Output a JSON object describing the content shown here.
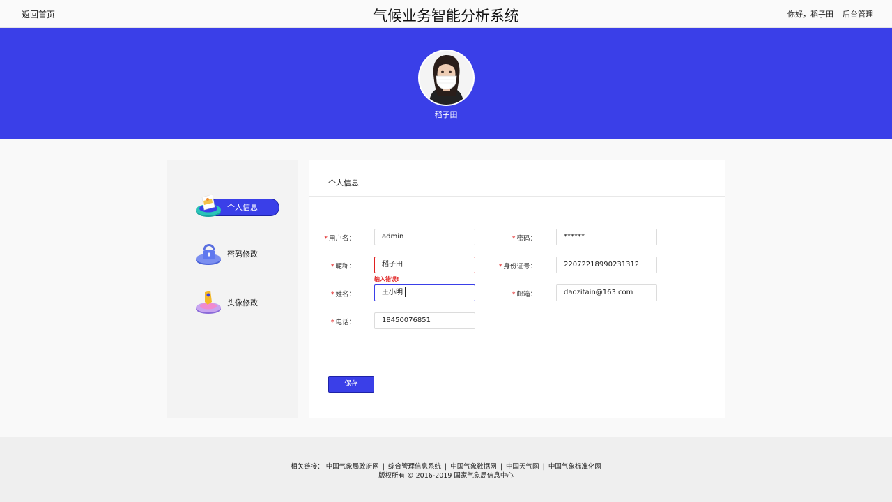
{
  "topbar": {
    "back_label": "返回首页",
    "title": "气候业务智能分析系统",
    "greeting": "你好，稻子田",
    "admin_label": "后台管理"
  },
  "banner": {
    "username": "稻子田",
    "bg_color": "#3a3fe8"
  },
  "sidebar": {
    "items": [
      {
        "label": "个人信息",
        "icon": "profile-card-icon",
        "active": true
      },
      {
        "label": "密码修改",
        "icon": "lock-icon",
        "active": false
      },
      {
        "label": "头像修改",
        "icon": "avatar-pen-icon",
        "active": false
      }
    ]
  },
  "panel": {
    "title": "个人信息",
    "fields": {
      "username": {
        "label": "用户名：",
        "value": "admin"
      },
      "password": {
        "label": "密码：",
        "value": "******"
      },
      "nickname": {
        "label": "昵称：",
        "value": "稻子田",
        "error": "输入错误!"
      },
      "idcard": {
        "label": "身份证号：",
        "value": "22072218990231312"
      },
      "realname": {
        "label": "姓名：",
        "value": "王小明"
      },
      "email": {
        "label": "邮箱：",
        "value": "daozitain@163.com"
      },
      "phone": {
        "label": "电话：",
        "value": "18450076851"
      }
    },
    "save_label": "保存"
  },
  "footer": {
    "links_prefix": "相关链接：",
    "links": [
      "中国气象局政府网",
      "综合管理信息系统",
      "中国气象数据网",
      "中国天气网",
      "中国气象标准化网"
    ],
    "separator": "|",
    "copyright": "版权所有 © 2016-2019 国家气象局信息中心"
  },
  "colors": {
    "accent": "#3a3fe8",
    "error": "#e02020"
  }
}
